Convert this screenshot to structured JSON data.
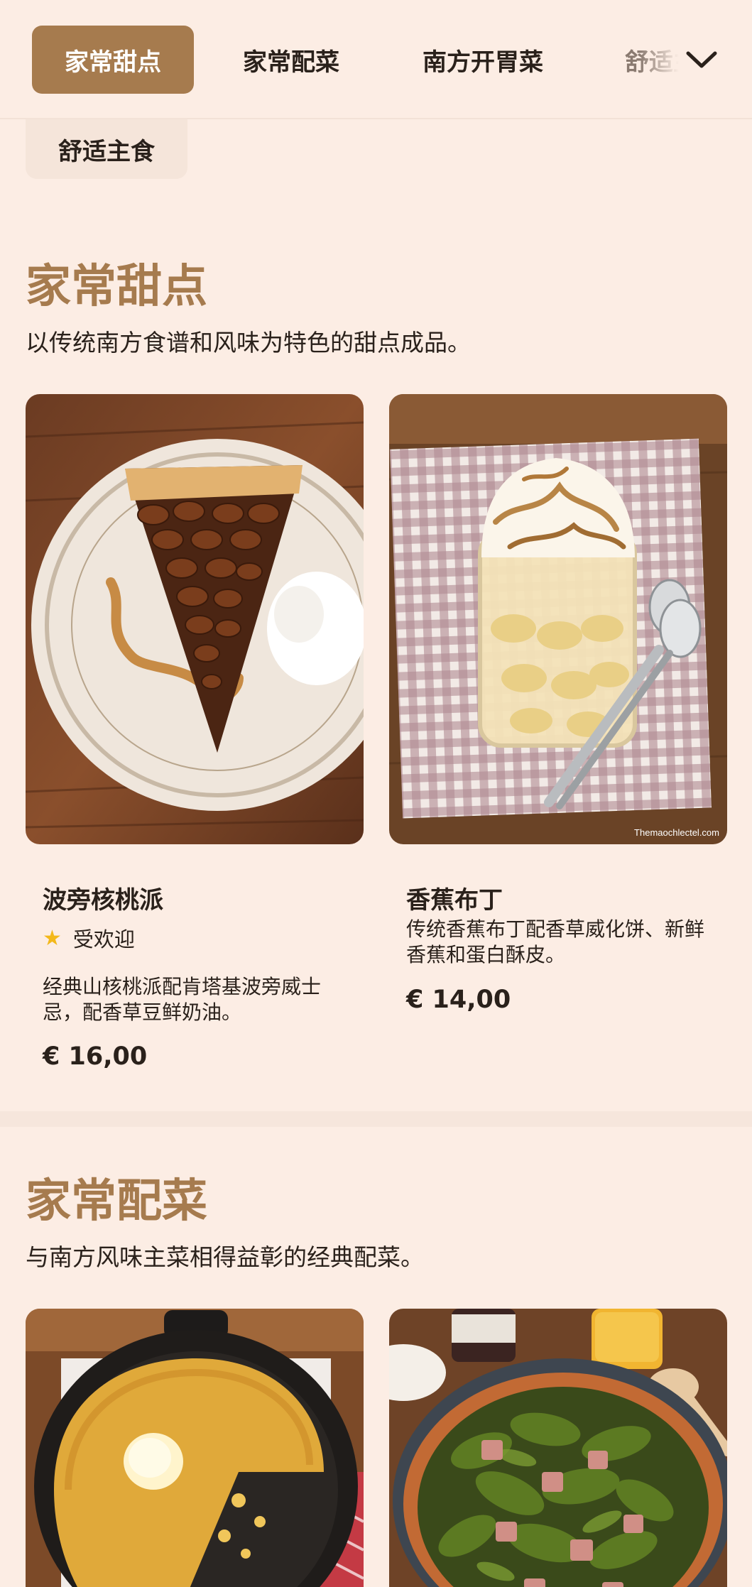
{
  "nav": {
    "tabs": [
      {
        "label": "家常甜点",
        "active": true
      },
      {
        "label": "家常配菜",
        "active": false
      },
      {
        "label": "南方开胃菜",
        "active": false
      },
      {
        "label": "舒适主食",
        "active": false
      }
    ],
    "expand_icon": "chevron-down-icon",
    "accent_color": "#a67b4e"
  },
  "overflow_chip": {
    "label": "舒适主食"
  },
  "sections": [
    {
      "title": "家常甜点",
      "description": "以传统南方食谱和风味为特色的甜点成品。",
      "items": [
        {
          "name": "波旁核桃派",
          "badge": "受欢迎",
          "badge_icon": "star-icon",
          "description": "经典山核桃派配肯塔基波旁威士忌，配香草豆鲜奶油。",
          "price": "€ 16,00"
        },
        {
          "name": "香蕉布丁",
          "description": "传统香蕉布丁配香草威化饼、新鲜香蕉和蛋白酥皮。",
          "price": "€ 14,00",
          "image_caption": "Themaochlectel.com"
        }
      ]
    },
    {
      "title": "家常配菜",
      "description": "与南方风味主菜相得益彰的经典配菜。",
      "items": [
        {
          "name": "",
          "image": "cornbread-skillet"
        },
        {
          "name": "",
          "image": "collard-greens"
        }
      ]
    }
  ]
}
